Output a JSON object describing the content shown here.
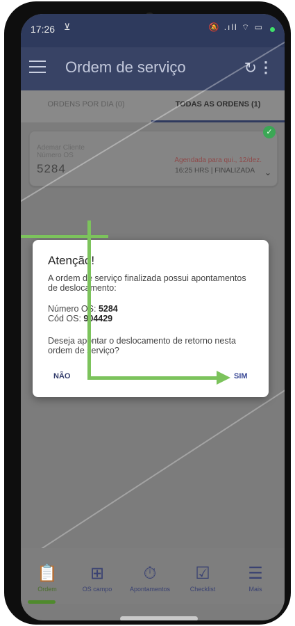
{
  "status": {
    "time": "17:26",
    "cast_icon": "cast-icon",
    "right_icons": "mute wifi signal battery",
    "battery": "65"
  },
  "app": {
    "title": "Ordem de serviço",
    "menu_icon": "menu-icon",
    "refresh_icon": "refresh-icon",
    "more_icon": "more-vert-icon"
  },
  "tabs": [
    {
      "label": "ORDENS POR DIA (0)"
    },
    {
      "label": "TODAS AS ORDENS (1)",
      "active": true
    }
  ],
  "order_card": {
    "client": "Ademar Cliente",
    "number_label": "Número OS",
    "number": "5284",
    "schedule": "Agendada para qui., 12/dez.",
    "time_status": "16:25 HRS  |  FINALIZADA",
    "status_icon": "check-circle-icon"
  },
  "dialog": {
    "title": "Atenção!",
    "message": "A ordem de serviço finalizada possui apontamentos de deslocamento:",
    "os_number_label": "Número OS: ",
    "os_number": "5284",
    "os_code_label": "Cód OS: ",
    "os_code": "904429",
    "question": "Deseja apontar o deslocamento de retorno nesta ordem de serviço?",
    "no_label": "NÃO",
    "yes_label": "SIM"
  },
  "bottom_nav": [
    {
      "label": "Ordem",
      "icon": "clipboard-icon",
      "active": true
    },
    {
      "label": "OS campo",
      "icon": "clipboard-plus-icon"
    },
    {
      "label": "Apontamentos",
      "icon": "stopwatch-icon"
    },
    {
      "label": "Checklist",
      "icon": "checklist-icon"
    },
    {
      "label": "Mais",
      "icon": "hamburger-icon"
    }
  ],
  "colors": {
    "appbar": "#384365",
    "accent": "#7cc35c",
    "active_tab": "#2f3a5e"
  }
}
